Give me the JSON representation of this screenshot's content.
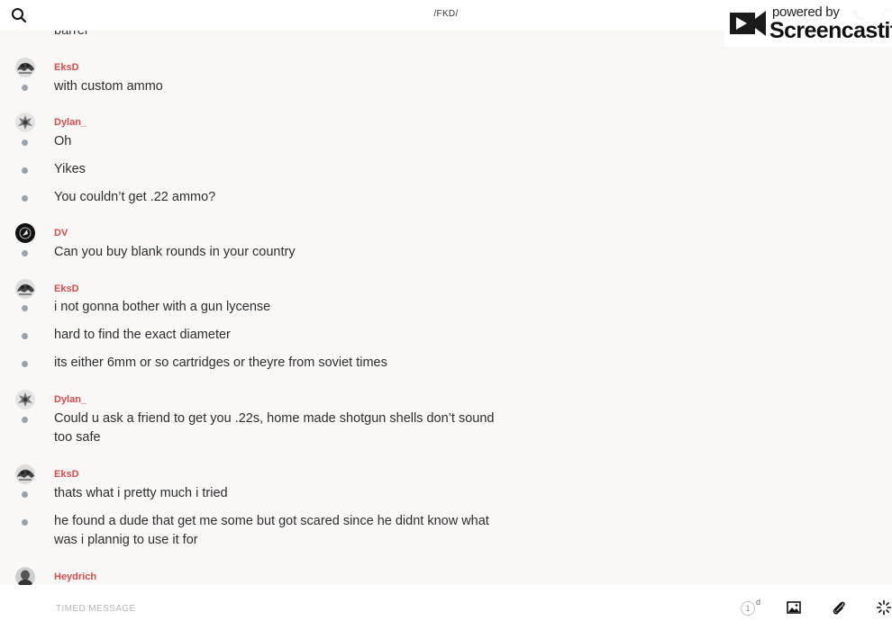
{
  "header": {
    "title": "/FKD/",
    "search_icon": "search-icon",
    "call_icon": "phone-icon",
    "info_icon": "info-icon"
  },
  "watermark": {
    "powered": "powered by",
    "brand": "Screencastify"
  },
  "clipped_text": "barrel",
  "colors": {
    "author": "#d94b4b",
    "bullet": "#9aa3ad",
    "background": "#f9f8f7"
  },
  "groups": [
    {
      "author": "EksD",
      "messages": [
        "with custom ammo"
      ]
    },
    {
      "author": "Dylan_",
      "messages": [
        "Oh",
        "Yikes",
        "You couldn’t get .22 ammo?"
      ]
    },
    {
      "author": "DV",
      "messages": [
        "Can you buy blank rounds in your country"
      ]
    },
    {
      "author": "EksD",
      "messages": [
        "i not gonna bother with a gun lycense",
        "hard to find the exact diameter",
        "its either 6mm or so cartridges or theyre from soviet times"
      ]
    },
    {
      "author": "Dylan_",
      "messages": [
        "Could u ask a friend to get you .22s, home made shotgun shells don’t sound too safe"
      ]
    },
    {
      "author": "EksD",
      "messages": [
        "thats what i pretty much i tried",
        "he found a dude that get me some but got scared since he didnt know what was i plannig to use it for"
      ]
    },
    {
      "author": "Heydrich",
      "messages": []
    }
  ],
  "composer": {
    "placeholder": "TIMED MESSAGE",
    "timer_value": "1",
    "timer_unit": "d",
    "image_icon": "image-icon",
    "attach_icon": "paperclip-icon",
    "more_icon": "sparkle-icon"
  }
}
